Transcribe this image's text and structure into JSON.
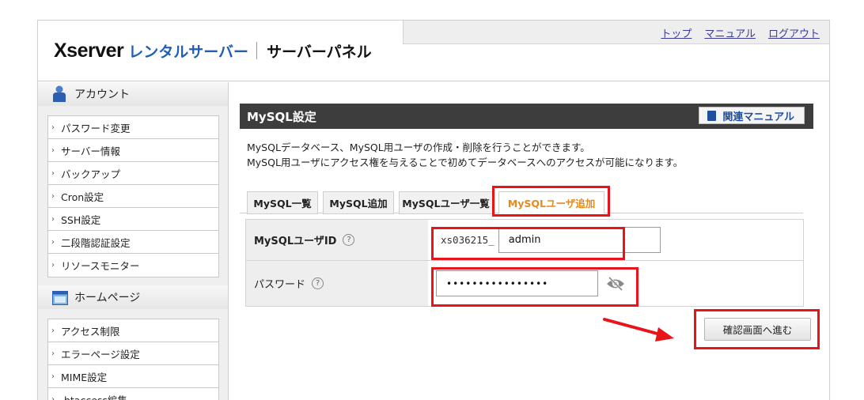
{
  "header": {
    "brand": "Xserver",
    "service": "レンタルサーバー",
    "panel": "サーバーパネル",
    "links": [
      "トップ",
      "マニュアル",
      "ログアウト"
    ]
  },
  "sidebar": {
    "sections": [
      {
        "title": "アカウント",
        "icon": "user-icon",
        "items": [
          "パスワード変更",
          "サーバー情報",
          "バックアップ",
          "Cron設定",
          "SSH設定",
          "二段階認証設定",
          "リソースモニター"
        ]
      },
      {
        "title": "ホームページ",
        "icon": "window-icon",
        "items": [
          "アクセス制限",
          "エラーページ設定",
          "MIME設定",
          ".htaccess編集"
        ]
      }
    ]
  },
  "main": {
    "title": "MySQL設定",
    "manual_button": "関連マニュアル",
    "description": [
      "MySQLデータベース、MySQL用ユーザの作成・削除を行うことができます。",
      "MySQL用ユーザにアクセス権を与えることで初めてデータベースへのアクセスが可能になります。"
    ],
    "tabs": [
      "MySQL一覧",
      "MySQL追加",
      "MySQLユーザ一覧",
      "MySQLユーザ追加"
    ],
    "active_tab": "MySQLユーザ追加",
    "form": {
      "user_id_label": "MySQLユーザID",
      "user_id_prefix": "xs036215_",
      "user_id_value": "admin",
      "password_label": "パスワード",
      "password_value": "••••••••••••••••"
    },
    "confirm_button": "確認画面へ進む"
  },
  "colors": {
    "accent_orange": "#e88a1a",
    "highlight_red": "#e8141a",
    "brand_blue": "#1f5fb5",
    "section_bar": "#3d3d3d"
  }
}
